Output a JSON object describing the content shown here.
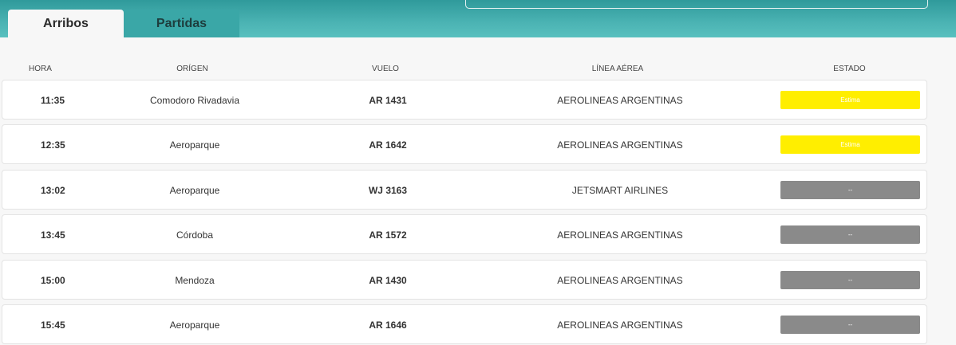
{
  "tabs": [
    {
      "label": "Arribos"
    },
    {
      "label": "Partidas"
    }
  ],
  "columns": {
    "hora": "HORA",
    "origen": "ORÍGEN",
    "vuelo": "VUELO",
    "linea": "LÍNEA AÉREA",
    "estado": "ESTADO"
  },
  "colors": {
    "header_teal": "#4bb3b3",
    "status_estima": "#ffee00",
    "status_none": "#8a8a8a"
  },
  "flights": [
    {
      "hora": "11:35",
      "origen": "Comodoro Rivadavia",
      "vuelo": "AR 1431",
      "linea": "AEROLINEAS ARGENTINAS",
      "estado": "Estima",
      "estado_color": "#ffee00"
    },
    {
      "hora": "12:35",
      "origen": "Aeroparque",
      "vuelo": "AR 1642",
      "linea": "AEROLINEAS ARGENTINAS",
      "estado": "Estima",
      "estado_color": "#ffee00"
    },
    {
      "hora": "13:02",
      "origen": "Aeroparque",
      "vuelo": "WJ 3163",
      "linea": "JETSMART AIRLINES",
      "estado": "--",
      "estado_color": "#8a8a8a"
    },
    {
      "hora": "13:45",
      "origen": "Córdoba",
      "vuelo": "AR 1572",
      "linea": "AEROLINEAS ARGENTINAS",
      "estado": "--",
      "estado_color": "#8a8a8a"
    },
    {
      "hora": "15:00",
      "origen": "Mendoza",
      "vuelo": "AR 1430",
      "linea": "AEROLINEAS ARGENTINAS",
      "estado": "--",
      "estado_color": "#8a8a8a"
    },
    {
      "hora": "15:45",
      "origen": "Aeroparque",
      "vuelo": "AR 1646",
      "linea": "AEROLINEAS ARGENTINAS",
      "estado": "--",
      "estado_color": "#8a8a8a"
    }
  ]
}
